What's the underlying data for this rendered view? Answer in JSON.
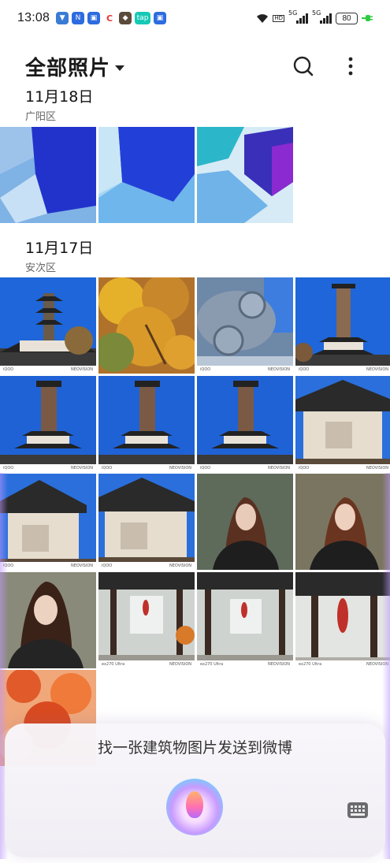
{
  "status_bar": {
    "time": "13:08",
    "notification_icons": [
      "shield-icon",
      "nfc-icon",
      "lock-icon",
      "c-icon",
      "photo-icon",
      "taptap-icon",
      "lock-icon"
    ],
    "network_label_1": "5G",
    "network_label_2": "5G",
    "hd_label": "HD",
    "battery": "80",
    "charging": true
  },
  "header": {
    "title": "全部照片",
    "search_icon": "search-icon",
    "more_icon": "more-vertical-icon"
  },
  "sections": [
    {
      "date": "11月18日",
      "place": "广阳区"
    },
    {
      "date": "11月17日",
      "place": "安次区"
    }
  ],
  "watermark": {
    "brand": "NEOVISION",
    "model_1": "iQOO",
    "model_2": "ex270 Ultra"
  },
  "assistant": {
    "query": "找一张建筑物图片发送到微博",
    "keyboard_icon": "keyboard-icon",
    "orb_icon": "voice-assistant-orb-icon"
  },
  "colors": {
    "sky": "#1f6fe0",
    "accent": "#2b7bff",
    "orb": "#c79bff",
    "charging": "#2ecc40"
  }
}
